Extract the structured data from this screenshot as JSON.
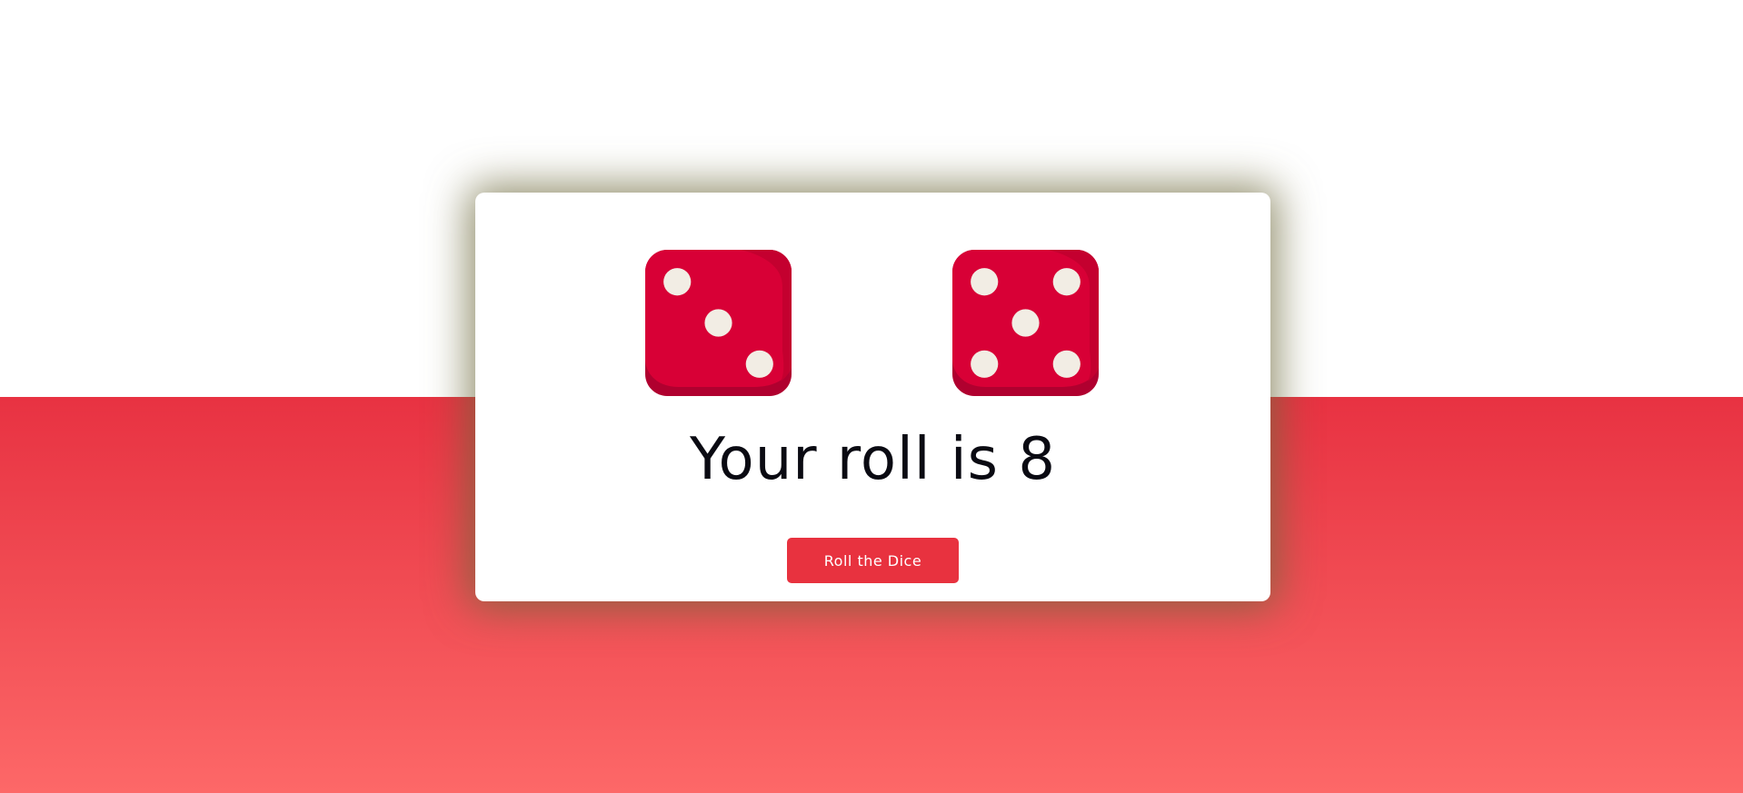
{
  "dice": {
    "left": {
      "value": 3,
      "icon": "dice-three-icon"
    },
    "right": {
      "value": 5,
      "icon": "dice-five-icon"
    }
  },
  "result": {
    "text": "Your roll is 8"
  },
  "roll_button": {
    "label": "Roll the Dice"
  },
  "colors": {
    "accent": "#e8323f",
    "die_face": "#d80036",
    "pip": "#f2ede4",
    "band_top": "#e83242",
    "band_bottom": "#fd6868"
  }
}
